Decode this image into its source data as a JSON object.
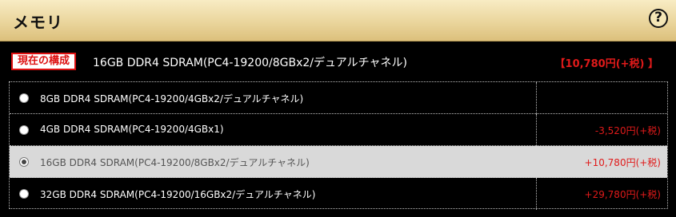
{
  "header": {
    "title": "メモリ",
    "help_symbol": "?"
  },
  "current": {
    "badge": "現在の構成",
    "name": "16GB DDR4 SDRAM(PC4-19200/8GBx2/デュアルチャネル)",
    "price": "【10,780円(+税) 】"
  },
  "options": [
    {
      "label": "8GB DDR4 SDRAM(PC4-19200/4GBx2/デュアルチャネル)",
      "price": "",
      "selected": false
    },
    {
      "label": "4GB DDR4 SDRAM(PC4-19200/4GBx1)",
      "price": "-3,520円(+税)",
      "selected": false
    },
    {
      "label": "16GB DDR4 SDRAM(PC4-19200/8GBx2/デュアルチャネル)",
      "price": "+10,780円(+税)",
      "selected": true
    },
    {
      "label": "32GB DDR4 SDRAM(PC4-19200/16GBx2/デュアルチャネル)",
      "price": "+29,780円(+税)",
      "selected": false
    }
  ],
  "colors": {
    "accent_red": "#e01a1a",
    "header_gold": "#ead59c",
    "selected_row": "#d9d9d9"
  }
}
